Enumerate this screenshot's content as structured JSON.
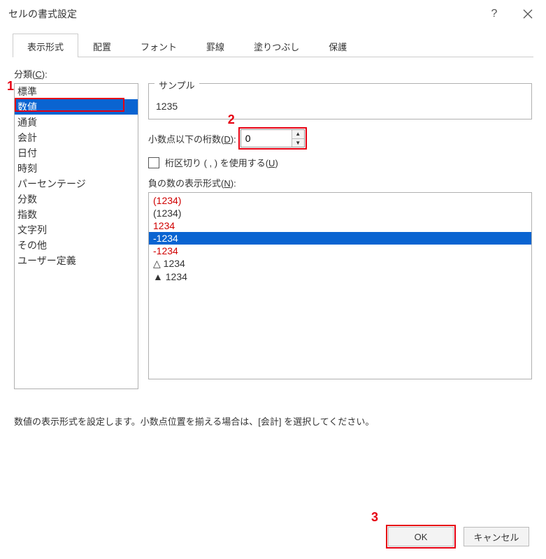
{
  "title": "セルの書式設定",
  "tabs": [
    "表示形式",
    "配置",
    "フォント",
    "罫線",
    "塗りつぶし",
    "保護"
  ],
  "category_label_pre": "分類(",
  "category_label_key": "C",
  "category_label_post": "):",
  "categories": [
    "標準",
    "数値",
    "通貨",
    "会計",
    "日付",
    "時刻",
    "パーセンテージ",
    "分数",
    "指数",
    "文字列",
    "その他",
    "ユーザー定義"
  ],
  "sample_label": "サンプル",
  "sample_value": "1235",
  "decimal_label_pre": "小数点以下の桁数(",
  "decimal_label_key": "D",
  "decimal_label_post": "):",
  "decimal_value": "0",
  "thousands_label_pre": "桁区切り ( , ) を使用する(",
  "thousands_label_key": "U",
  "thousands_label_post": ")",
  "neg_label_pre": "負の数の表示形式(",
  "neg_label_key": "N",
  "neg_label_post": "):",
  "neg_items": [
    {
      "text": "(1234)",
      "cls": "red"
    },
    {
      "text": "(1234)",
      "cls": ""
    },
    {
      "text": "1234",
      "cls": "red"
    },
    {
      "text": "-1234",
      "cls": "selected"
    },
    {
      "text": "-1234",
      "cls": "red"
    },
    {
      "text": "△ 1234",
      "cls": ""
    },
    {
      "text": "▲ 1234",
      "cls": ""
    }
  ],
  "description": "数値の表示形式を設定します。小数点位置を揃える場合は、[会計] を選択してください。",
  "ok_label": "OK",
  "cancel_label": "キャンセル",
  "annot1": "1",
  "annot2": "2",
  "annot3": "3"
}
